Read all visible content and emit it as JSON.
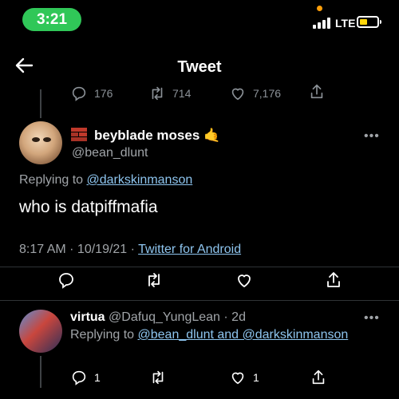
{
  "status_bar": {
    "time": "3:21",
    "network": "LTE"
  },
  "header": {
    "back_icon": "back-arrow-icon",
    "title": "Tweet"
  },
  "prev_tweet_stats": {
    "replies": "176",
    "retweets": "714",
    "likes": "7,176"
  },
  "main_tweet": {
    "display_name": "beyblade moses",
    "handle": "@bean_dlunt",
    "replying_label": "Replying to",
    "replying_to": "@darkskinmanson",
    "text": "who is datpiffmafia",
    "time": "8:17 AM · 10/19/21 ·",
    "source": "Twitter for Android"
  },
  "reply_tweet": {
    "display_name": "virtua",
    "handle": "@Dafuq_YungLean",
    "age": "· 2d",
    "replying_label": "Replying to",
    "replying_to": "@bean_dlunt and @darkskinmanson",
    "replies": "1",
    "likes": "1"
  },
  "colors": {
    "link": "#8ec5ef",
    "muted": "#a0a4a8",
    "status_pill": "#30c758",
    "battery": "#ffd60a"
  }
}
